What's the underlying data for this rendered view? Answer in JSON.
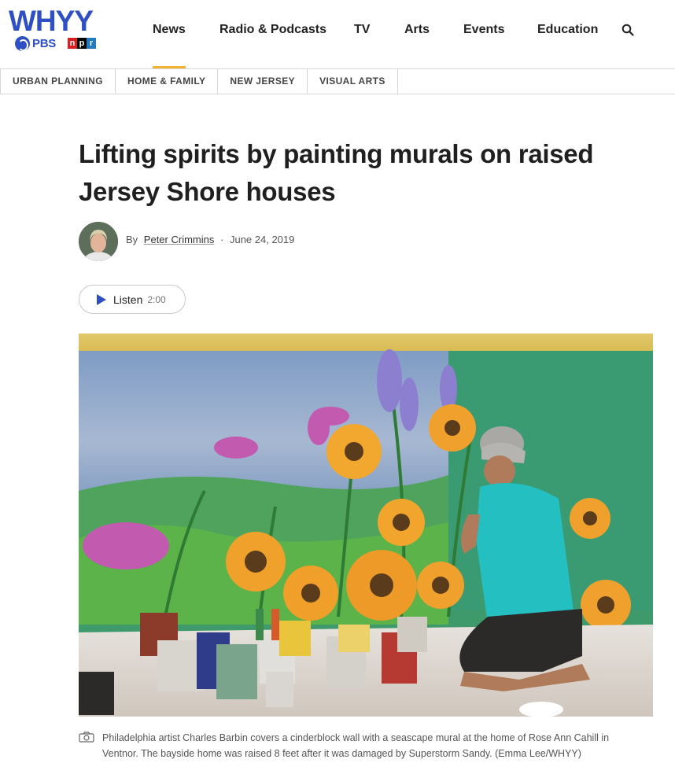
{
  "brand": {
    "name": "WHYY",
    "pbs_label": "PBS",
    "npr_letters": [
      "n",
      "p",
      "r"
    ],
    "primary_color": "#2f50c4",
    "accent_color": "#f5b335"
  },
  "nav": {
    "items": [
      {
        "label": "News"
      },
      {
        "label": "Radio & Podcasts"
      },
      {
        "label": "TV"
      },
      {
        "label": "Arts"
      },
      {
        "label": "Events"
      },
      {
        "label": "Education"
      }
    ],
    "active": "News",
    "search_icon": "search-icon"
  },
  "tags": [
    {
      "label": "URBAN PLANNING"
    },
    {
      "label": "HOME & FAMILY"
    },
    {
      "label": "NEW JERSEY"
    },
    {
      "label": "VISUAL ARTS"
    }
  ],
  "article": {
    "title": "Lifting spirits by painting murals on raised Jersey Shore houses",
    "byline_prefix": "By",
    "author": "Peter Crimmins",
    "separator": "·",
    "date": "June 24, 2019",
    "listen": {
      "label": "Listen",
      "duration": "2:00"
    },
    "caption": "Philadelphia artist Charles Barbin covers a cinderblock wall with a seascape mural at the home of Rose Ann Cahill in Ventnor. The bayside home was raised 8 feet after it was damaged by Superstorm Sandy. (Emma Lee/WHYY)"
  }
}
